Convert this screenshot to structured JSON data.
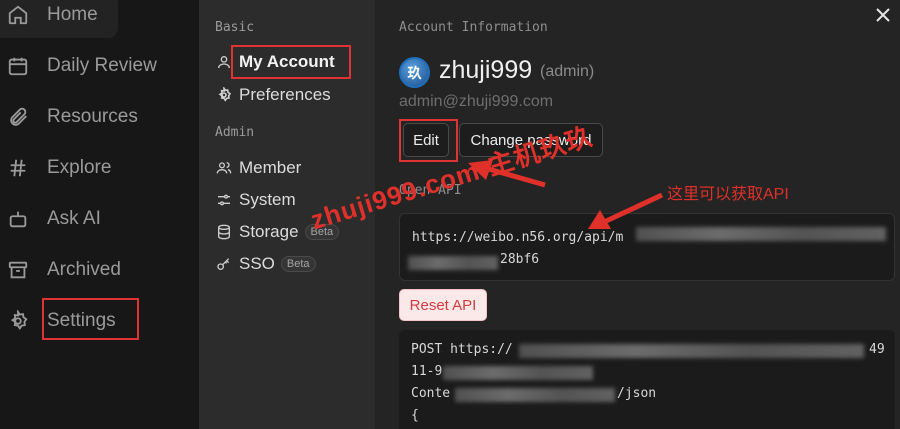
{
  "nav": {
    "items": [
      {
        "label": "Home",
        "icon": "home-icon"
      },
      {
        "label": "Daily Review",
        "icon": "calendar-icon"
      },
      {
        "label": "Resources",
        "icon": "paperclip-icon"
      },
      {
        "label": "Explore",
        "icon": "hash-icon"
      },
      {
        "label": "Ask AI",
        "icon": "bot-icon"
      },
      {
        "label": "Archived",
        "icon": "archive-icon"
      },
      {
        "label": "Settings",
        "icon": "gear-icon"
      }
    ]
  },
  "settings_menu": {
    "basic_title": "Basic",
    "admin_title": "Admin",
    "items": [
      {
        "label": "My Account",
        "icon": "user-icon"
      },
      {
        "label": "Preferences",
        "icon": "gear-icon"
      },
      {
        "label": "Member",
        "icon": "users-icon"
      },
      {
        "label": "System",
        "icon": "sliders-icon"
      },
      {
        "label": "Storage",
        "icon": "database-icon",
        "badge": "Beta"
      },
      {
        "label": "SSO",
        "icon": "key-icon",
        "badge": "Beta"
      }
    ]
  },
  "account": {
    "section_title": "Account Information",
    "avatar_text": "玖",
    "username": "zhuji999",
    "role": "(admin)",
    "email": "admin@zhuji999.com",
    "edit_label": "Edit",
    "change_password_label": "Change password"
  },
  "open_api": {
    "label": "Open API",
    "url_start": "https://weibo.n56.org/api/m",
    "url_end": "28bf6",
    "reset_label": "Reset API"
  },
  "code": {
    "line1_start": "POST https://",
    "line1_end": "49",
    "line2_start": "11-9",
    "line3_start": "Conte",
    "line3_end": "/json",
    "line4": "{"
  },
  "annotations": {
    "watermark": "zhuji999.com-主机玖玖",
    "note": "这里可以获取API",
    "color": "#e0302a"
  },
  "colors": {
    "accent_red": "#e03434",
    "reset_text": "#d23a3f"
  }
}
